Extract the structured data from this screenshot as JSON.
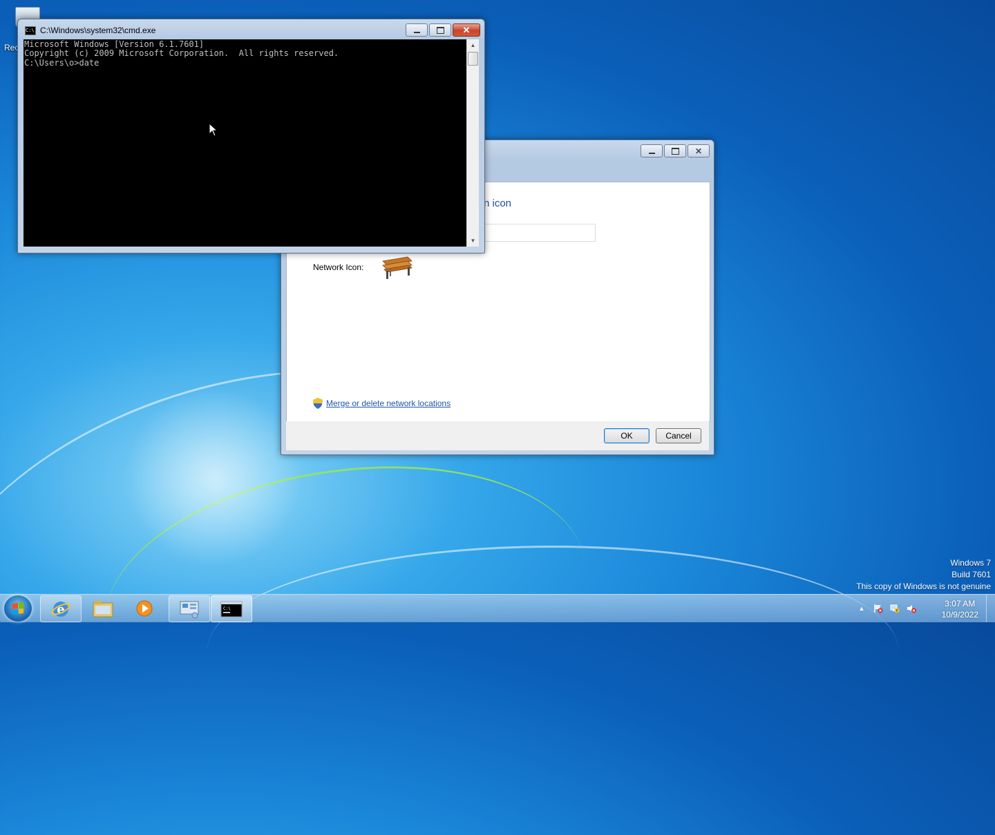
{
  "desktop": {
    "recycle_bin_label": "Rec",
    "watermark": {
      "line1": "Windows 7",
      "line2": "Build 7601",
      "line3": "This copy of Windows is not genuine"
    }
  },
  "cmd_window": {
    "title": "C:\\Windows\\system32\\cmd.exe",
    "icon_text": "C:\\",
    "console_lines": [
      "Microsoft Windows [Version 6.1.7601]",
      "Copyright (c) 2009 Microsoft Corporation.  All rights reserved.",
      "",
      "C:\\Users\\o>date"
    ]
  },
  "network_dialog": {
    "heading_partial": "n icon",
    "network_icon_label": "Network Icon:",
    "merge_link": "Merge or delete network locations",
    "ok_label": "OK",
    "cancel_label": "Cancel"
  },
  "taskbar": {
    "pinned": [
      "internet-explorer",
      "windows-explorer",
      "media-player",
      "network-sharing-center",
      "command-prompt"
    ],
    "active": "command-prompt",
    "clock": {
      "time": "3:07 AM",
      "date": "10/9/2022"
    },
    "tray_arrow": "▲"
  },
  "colors": {
    "link": "#1d57a8",
    "heading": "#1e4fa0",
    "close_button": "#c7442a"
  }
}
